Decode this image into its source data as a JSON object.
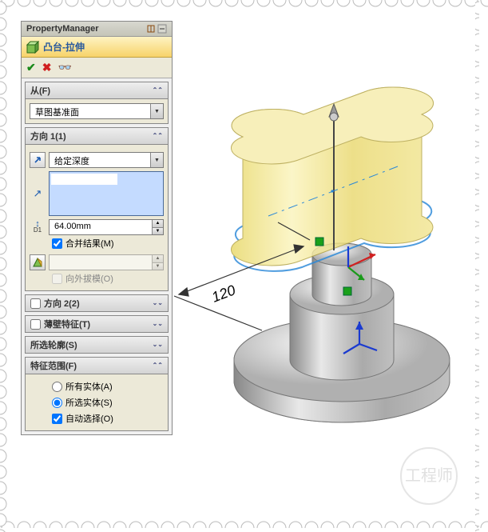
{
  "header": {
    "title": "PropertyManager"
  },
  "feature": {
    "title": "凸台-拉伸"
  },
  "sections": {
    "from": {
      "label": "从(F)",
      "dropdown": "草图基准面"
    },
    "dir1": {
      "label": "方向 1(1)",
      "endcond": "给定深度",
      "depth": "64.00mm",
      "merge": "合并结果(M)",
      "draft": "向外拔模(O)"
    },
    "dir2": {
      "label": "方向 2(2)"
    },
    "thin": {
      "label": "薄壁特征(T)"
    },
    "contour": {
      "label": "所选轮廓(S)"
    },
    "scope": {
      "label": "特征范围(F)",
      "opt_all": "所有实体(A)",
      "opt_sel": "所选实体(S)",
      "auto": "自动选择(O)"
    }
  },
  "viewport": {
    "dimension": "120"
  },
  "watermark": "工程师"
}
